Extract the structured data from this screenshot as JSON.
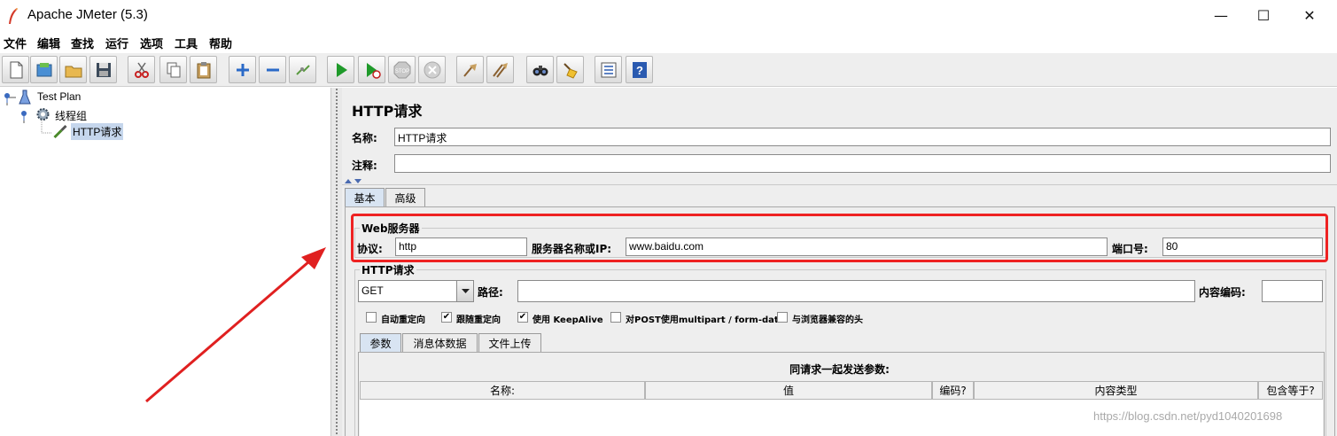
{
  "window": {
    "title": "Apache JMeter (5.3)",
    "controls": {
      "minimize": "—",
      "maximize": "☐",
      "close": "✕"
    }
  },
  "menu": [
    "文件",
    "编辑",
    "查找",
    "运行",
    "选项",
    "工具",
    "帮助"
  ],
  "toolbar": {
    "icons": [
      "new-icon",
      "templates-icon",
      "open-icon",
      "save-icon",
      "cut-icon",
      "copy-icon",
      "paste-icon",
      "expand-icon",
      "collapse-icon",
      "toggle-icon",
      "start-icon",
      "start-no-pause-icon",
      "stop-icon",
      "shutdown-icon",
      "clear-icon",
      "clear-all-icon",
      "search-icon",
      "reset-search-icon",
      "function-helper-icon",
      "help-icon"
    ],
    "stop_label": "STOP"
  },
  "tree": {
    "items": [
      {
        "label": "Test Plan",
        "icon": "test-plan-icon"
      },
      {
        "label": "线程组",
        "icon": "thread-group-gear-icon"
      },
      {
        "label": "HTTP请求",
        "icon": "http-sampler-pipette-icon",
        "selected": true
      }
    ]
  },
  "panel": {
    "title": "HTTP请求",
    "name_label": "名称:",
    "name_value": "HTTP请求",
    "comment_label": "注释:",
    "comment_value": "",
    "tabs": [
      "基本",
      "高级"
    ],
    "active_tab": "基本",
    "web_server": {
      "legend": "Web服务器",
      "protocol_label": "协议:",
      "protocol_value": "http",
      "server_label": "服务器名称或IP:",
      "server_value": "www.baidu.com",
      "port_label": "端口号:",
      "port_value": "80"
    },
    "http_request": {
      "legend": "HTTP请求",
      "method": "GET",
      "path_label": "路径:",
      "path_value": "",
      "encoding_label": "内容编码:",
      "encoding_value": "",
      "checkboxes": [
        {
          "label": "自动重定向",
          "checked": false
        },
        {
          "label": "跟随重定向",
          "checked": true
        },
        {
          "label": "使用 KeepAlive",
          "checked": true
        },
        {
          "label": "对POST使用multipart / form-data",
          "checked": false
        },
        {
          "label": "与浏览器兼容的头",
          "checked": false
        }
      ],
      "subtabs": [
        "参数",
        "消息体数据",
        "文件上传"
      ],
      "params_title": "同请求一起发送参数:",
      "columns": [
        "名称:",
        "值",
        "编码?",
        "内容类型",
        "包含等于?"
      ]
    }
  },
  "watermark": "https://blog.csdn.net/pyd1040201698",
  "colors": {
    "highlight_border": "#ee2222",
    "arrow": "#e02020",
    "selection": "#c5d6ec",
    "panel_bg": "#eeeeee"
  }
}
